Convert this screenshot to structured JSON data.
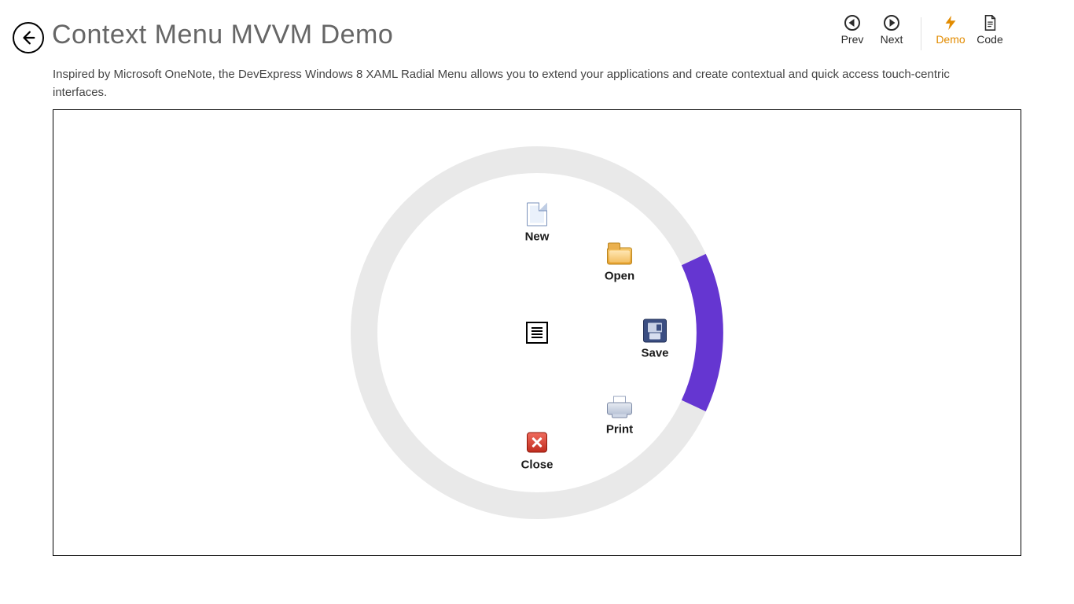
{
  "header": {
    "title": "Context Menu MVVM Demo",
    "actions": {
      "prev": "Prev",
      "next": "Next",
      "demo": "Demo",
      "code": "Code"
    }
  },
  "description": "Inspired by Microsoft OneNote, the DevExpress Windows 8 XAML Radial Menu allows you to extend your applications and create contextual and quick access touch-centric interfaces.",
  "radial": {
    "ring_color_bg": "#e9e9e9",
    "ring_color_highlight": "#6536d1",
    "highlight_segment": "save",
    "center_icon": "document-icon",
    "items": [
      {
        "id": "new",
        "label": "New",
        "icon": "file-new-icon"
      },
      {
        "id": "open",
        "label": "Open",
        "icon": "folder-open-icon"
      },
      {
        "id": "save",
        "label": "Save",
        "icon": "floppy-save-icon"
      },
      {
        "id": "print",
        "label": "Print",
        "icon": "printer-icon"
      },
      {
        "id": "close",
        "label": "Close",
        "icon": "close-icon"
      }
    ]
  }
}
